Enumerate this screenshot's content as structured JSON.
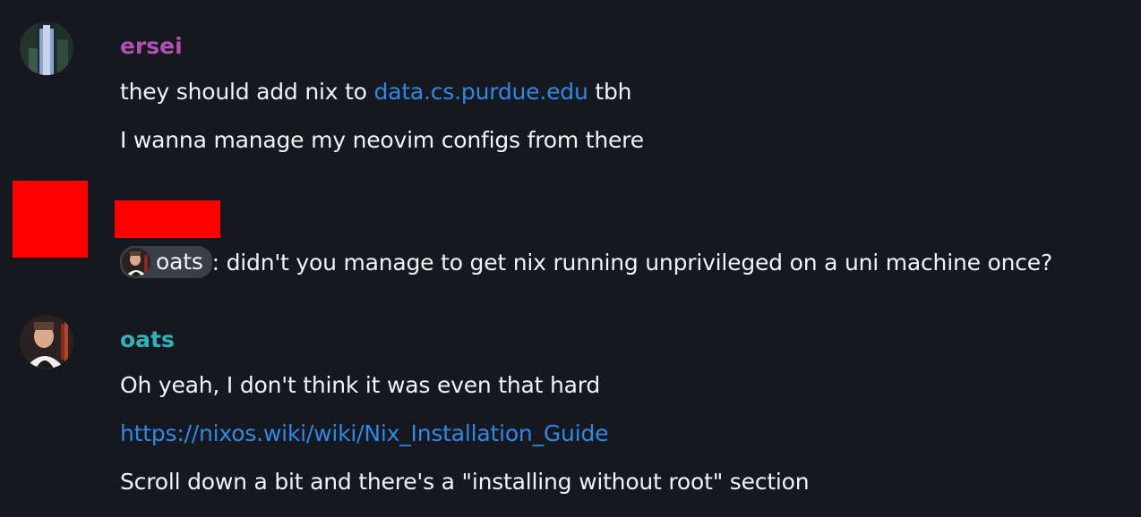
{
  "messages": [
    {
      "author": "ersei",
      "author_color": "#b04fb5",
      "avatar_icon": "waterfall-avatar",
      "lines": [
        {
          "before": "they should add nix to ",
          "link": "data.cs.purdue.edu",
          "after": " tbh"
        },
        {
          "text": "I wanna manage my neovim configs from there"
        }
      ]
    },
    {
      "author_redacted": true,
      "mention": "oats",
      "text": ": didn't you manage to get nix running unprivileged on a uni machine once?"
    },
    {
      "author": "oats",
      "author_color": "#2fb3b8",
      "avatar_icon": "person-avatar",
      "lines": [
        {
          "text": "Oh yeah, I don't think it was even that hard"
        },
        {
          "link": "https://nixos.wiki/wiki/Nix_Installation_Guide"
        },
        {
          "text": "Scroll down a bit and there's a \"installing without root\" section"
        }
      ]
    }
  ]
}
